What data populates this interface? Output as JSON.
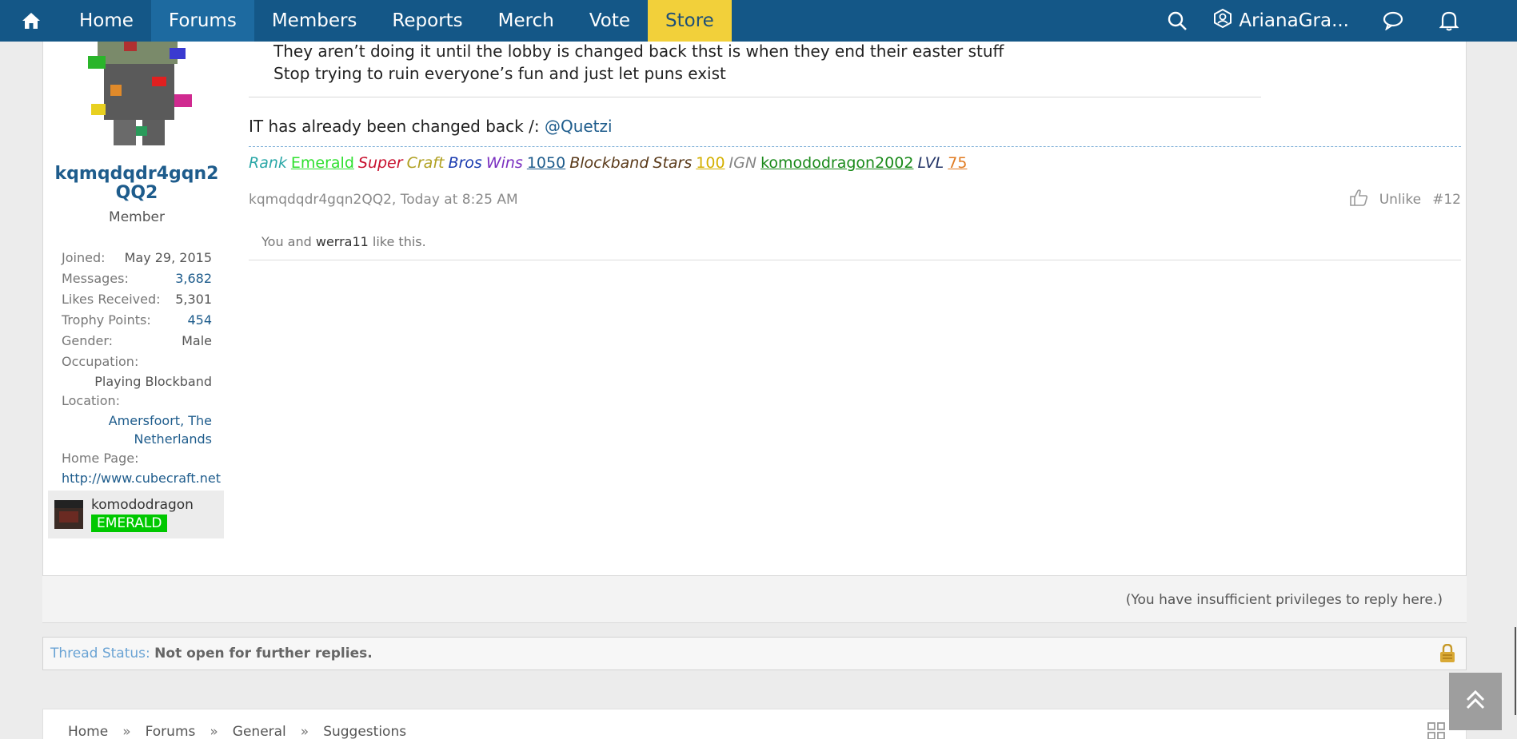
{
  "nav": {
    "items": [
      {
        "label": "Home",
        "active": false
      },
      {
        "label": "Forums",
        "active": true
      },
      {
        "label": "Members",
        "active": false
      },
      {
        "label": "Reports",
        "active": false
      },
      {
        "label": "Merch",
        "active": false
      },
      {
        "label": "Vote",
        "active": false
      },
      {
        "label": "Store",
        "active": false
      }
    ],
    "user_name": "ArianaGra...",
    "colors": {
      "bar": "#145787",
      "active": "#1d6aa0",
      "store": "#f2d03a"
    }
  },
  "author": {
    "username": "kqmqdqdr4gqn2QQ2",
    "title": "Member",
    "stats": {
      "joined_label": "Joined:",
      "joined": "May 29, 2015",
      "messages_label": "Messages:",
      "messages": "3,682",
      "likes_label": "Likes Received:",
      "likes": "5,301",
      "trophy_label": "Trophy Points:",
      "trophy": "454",
      "gender_label": "Gender:",
      "gender": "Male",
      "occupation_label": "Occupation:",
      "occupation": "Playing Blockband",
      "location_label": "Location:",
      "location_line1": "Amersfoort, The",
      "location_line2": "Netherlands",
      "homepage_label": "Home Page:",
      "homepage": "http://www.cubecraft.net"
    },
    "game": {
      "ign": "komododragon",
      "rank": "EMERALD",
      "rank_color": "#00c800"
    }
  },
  "post": {
    "quote_lines": [
      "They aren’t doing it until the lobby is changed back thst is when they end their easter stuff",
      "Stop trying to ruin everyone’s fun and just let puns exist"
    ],
    "message_prefix": "IT has already been changed back /: ",
    "mention": "@Quetzi",
    "signature": [
      {
        "text": "Rank",
        "color": "#2aa7a7",
        "underline": false
      },
      {
        "text": "Emerald",
        "color": "#2fe02f",
        "underline": true
      },
      {
        "text": "Super",
        "color": "#c8102e",
        "underline": false
      },
      {
        "text": "Craft",
        "color": "#b0a020",
        "underline": false
      },
      {
        "text": "Bros",
        "color": "#1a3bb0",
        "underline": false
      },
      {
        "text": "Wins",
        "color": "#7a2fc0",
        "underline": false
      },
      {
        "text": "1050",
        "color": "#1e5c8c",
        "underline": true
      },
      {
        "text": "Blockband",
        "color": "#5a3a1a",
        "underline": false
      },
      {
        "text": "Stars",
        "color": "#5a3a1a",
        "underline": false
      },
      {
        "text": "100",
        "color": "#d4b000",
        "underline": true
      },
      {
        "text": "IGN",
        "color": "#888888",
        "underline": false
      },
      {
        "text": "komododragon2002",
        "color": "#1a8a1a",
        "underline": true
      },
      {
        "text": "LVL",
        "color": "#223366",
        "underline": false
      },
      {
        "text": "75",
        "color": "#e07a20",
        "underline": true
      }
    ],
    "meta": "kqmqdqdr4gqn2QQ2, Today at 8:25 AM",
    "unlike_label": "Unlike",
    "post_number": "#12",
    "likes_prefix": "You and ",
    "likes_user": "werra11",
    "likes_suffix": " like this."
  },
  "reply_notice": "(You have insufficient privileges to reply here.)",
  "thread_status": {
    "label": "Thread Status:",
    "value": "Not open for further replies."
  },
  "breadcrumb": [
    "Home",
    "Forums",
    "General",
    "Suggestions"
  ],
  "breadcrumb_sep": "»"
}
